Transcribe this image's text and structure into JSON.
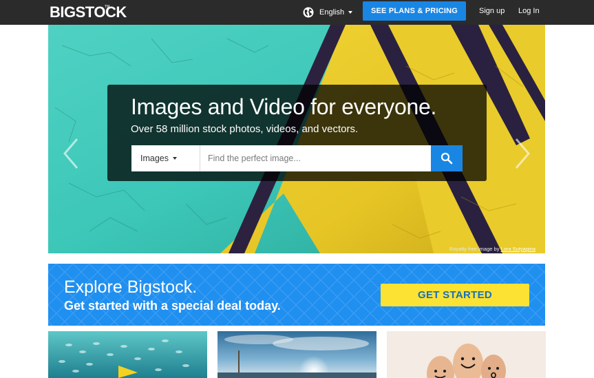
{
  "header": {
    "logo": "BIGSTOCK",
    "logo_tm": "TM",
    "language": "English",
    "plans_button": "SEE PLANS & PRICING",
    "signup": "Sign up",
    "login": "Log In"
  },
  "hero": {
    "headline": "Images and Video for everyone.",
    "subline": "Over 58 million stock photos, videos, and vectors.",
    "search_type": "Images",
    "search_placeholder": "Find the perfect image...",
    "credit_prefix": "Royalty free image by",
    "credit_author": "Lora Sutyagina"
  },
  "promo": {
    "title": "Explore Bigstock.",
    "subtitle": "Get started with a special deal today.",
    "cta": "GET STARTED"
  },
  "colors": {
    "topbar": "#2b2b2b",
    "accent_blue": "#1a86e4",
    "promo_blue": "#1f8ff0",
    "cta_yellow": "#fbe233",
    "hero_teal": "#3cc7b8",
    "hero_yellow": "#e8cc2a"
  },
  "icons": [
    "globe-icon",
    "chevron-down-icon",
    "search-icon",
    "chevron-left-icon",
    "chevron-right-icon"
  ]
}
